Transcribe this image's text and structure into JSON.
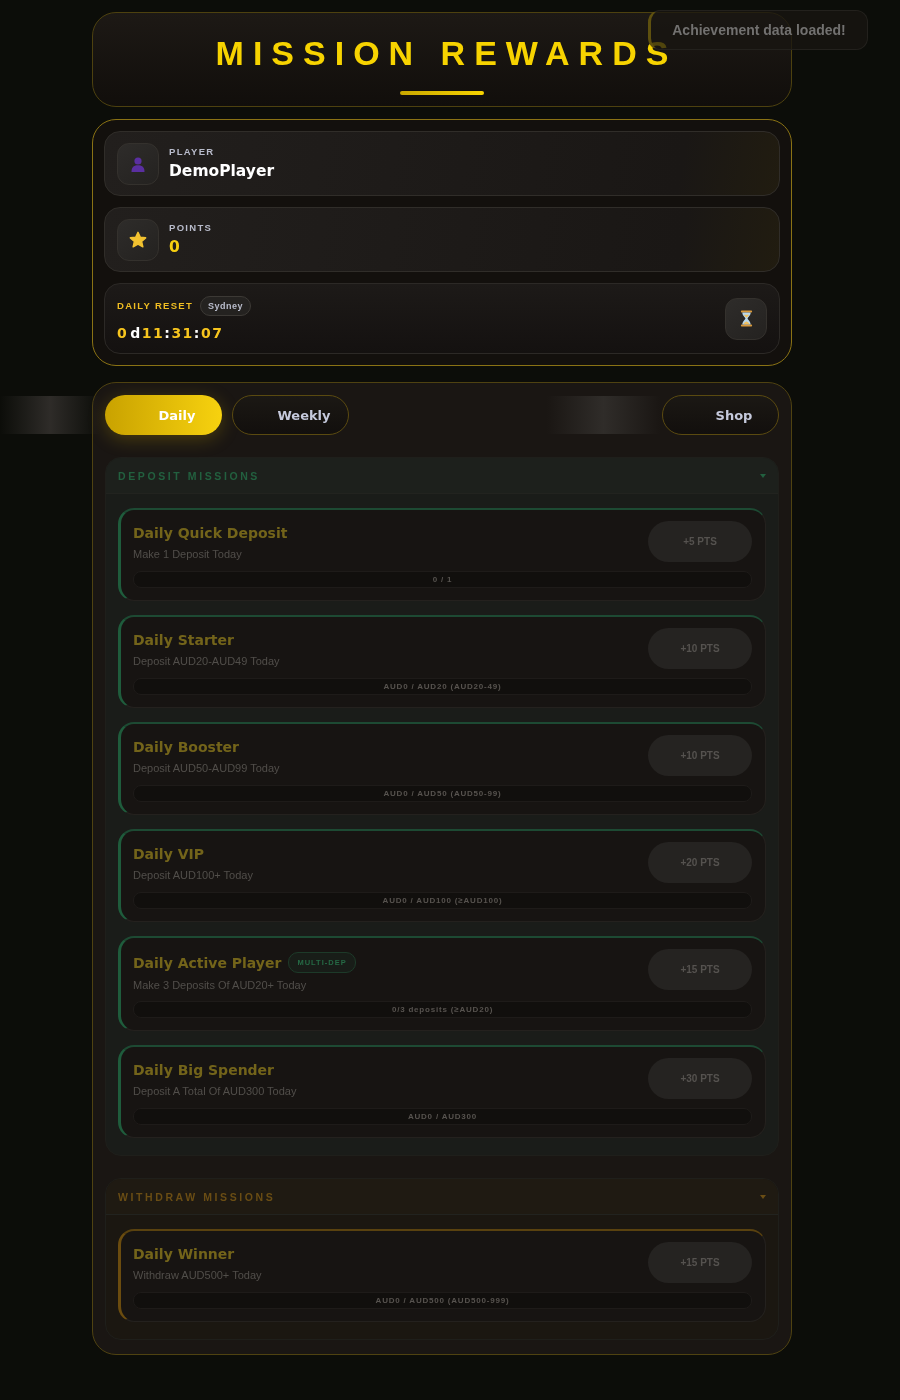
{
  "header": {
    "title": "MISSION REWARDS"
  },
  "toast": {
    "text": "Achievement data loaded!"
  },
  "stats": [
    {
      "kind": "player",
      "label": "PLAYER",
      "value": "DemoPlayer"
    },
    {
      "kind": "points",
      "label": "POINTS",
      "value": "0"
    }
  ],
  "reset": {
    "label": "DAILY RESET",
    "timezone": "Sydney",
    "countdown": [
      {
        "kind": "value",
        "text": "0"
      },
      {
        "kind": "unit",
        "text": "d"
      },
      {
        "kind": "value",
        "text": "11"
      },
      {
        "kind": "sep",
        "text": ":"
      },
      {
        "kind": "value",
        "text": "31"
      },
      {
        "kind": "sep",
        "text": ":"
      },
      {
        "kind": "value",
        "text": "07"
      }
    ]
  },
  "tabs": [
    {
      "label": "Daily",
      "selected": true
    },
    {
      "label": "Weekly",
      "selected": false
    },
    {
      "label": "Shop",
      "selected": false
    }
  ],
  "sections": [
    {
      "kind": "deposit",
      "title": "DEPOSIT MISSIONS",
      "expanded": true,
      "missions": [
        {
          "title": "Daily Quick Deposit",
          "description": "Make 1 Deposit Today",
          "reward": "+5 PTS",
          "progress": "0 / 1",
          "level": 0
        },
        {
          "title": "Daily Starter",
          "description": "Deposit AUD20-AUD49 Today",
          "reward": "+10 PTS",
          "progress": "AUD0 / AUD20 (AUD20-49)",
          "level": 0
        },
        {
          "title": "Daily Booster",
          "description": "Deposit AUD50-AUD99 Today",
          "reward": "+10 PTS",
          "progress": "AUD0 / AUD50 (AUD50-99)",
          "level": 0
        },
        {
          "title": "Daily VIP",
          "description": "Deposit AUD100+ Today",
          "reward": "+20 PTS",
          "progress": "AUD0 / AUD100 (≥AUD100)",
          "level": 0
        },
        {
          "title": "Daily Active Player",
          "badge": "MULTI-DEP",
          "description": "Make 3 Deposits Of AUD20+ Today",
          "reward": "+15 PTS",
          "progress": "0/3 deposits (≥AUD20)",
          "level": 0
        },
        {
          "title": "Daily Big Spender",
          "description": "Deposit A Total Of AUD300 Today",
          "reward": "+30 PTS",
          "progress": "AUD0 / AUD300",
          "level": 0
        }
      ]
    },
    {
      "kind": "withdraw",
      "title": "WITHDRAW MISSIONS",
      "expanded": true,
      "missions": [
        {
          "title": "Daily Winner",
          "description": "Withdraw AUD500+ Today",
          "reward": "+15 PTS",
          "progress": "AUD0 / AUD500 (AUD500-999)",
          "level": 0
        }
      ]
    }
  ]
}
